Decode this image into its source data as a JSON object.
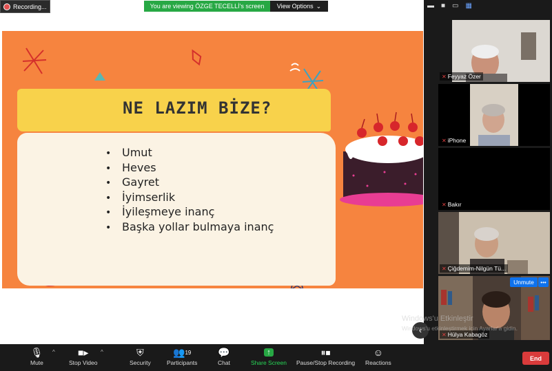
{
  "recording": {
    "label": "Recording..."
  },
  "banner": {
    "viewing": "You are viewing ÖZGE TECELLİ's screen",
    "view_options": "View Options"
  },
  "slide": {
    "title": "NE LAZIM BİZE?",
    "bullets": [
      "Umut",
      "Heves",
      "Gayret",
      "İyimserlik",
      "İyileşmeye inanç",
      "Başka yollar bulmaya inanç"
    ]
  },
  "participants": [
    {
      "name": "Feyyaz Özer"
    },
    {
      "name": "iPhone"
    },
    {
      "name": "Bakır"
    },
    {
      "name": "Çiğdemim-Nilgün Tü..."
    },
    {
      "name": "Hülya Kabagöz"
    }
  ],
  "unmute": {
    "label": "Unmute",
    "more": "•••"
  },
  "watermark": {
    "line1": "Windows'u Etkinleştir",
    "line2": "Windows'u etkinleştirmek için Ayarlar'a gidin."
  },
  "toolbar": {
    "mute": "Mute",
    "stop_video": "Stop Video",
    "security": "Security",
    "participants": "Participants",
    "participants_count": "19",
    "chat": "Chat",
    "share_screen": "Share Screen",
    "pause_recording": "Pause/Stop Recording",
    "reactions": "Reactions",
    "end": "End"
  },
  "colors": {
    "slide_bg": "#f6843f",
    "title_band": "#f8d24b",
    "share_green": "#27a844",
    "end_red": "#d93b3b",
    "unmute_blue": "#0e72ed"
  }
}
